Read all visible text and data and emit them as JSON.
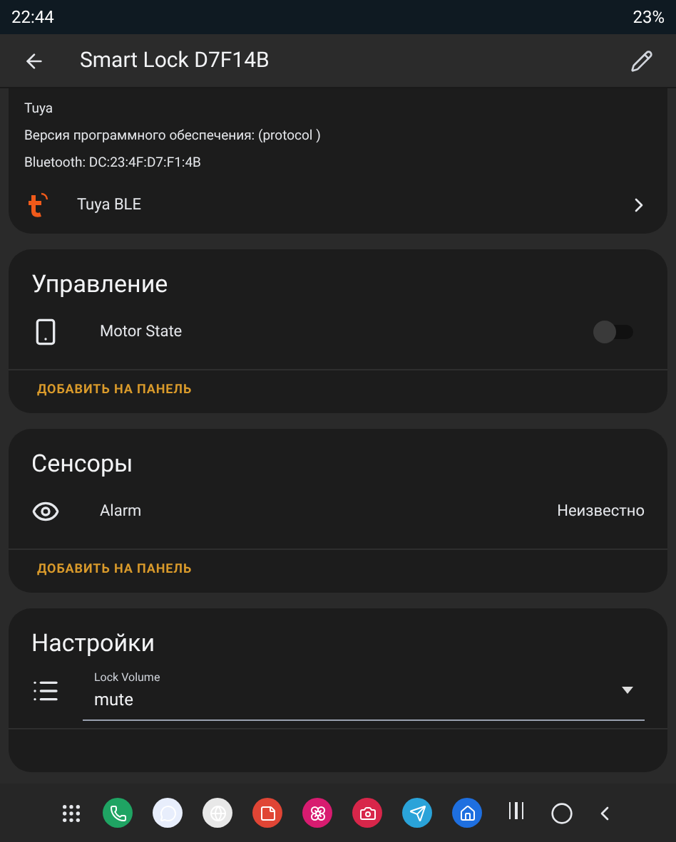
{
  "status_bar": {
    "time": "22:44",
    "battery": "23%"
  },
  "app_bar": {
    "title": "Smart Lock D7F14B"
  },
  "device_info": {
    "lines": [
      "Tuya",
      "Версия программного обеспечения: (protocol )",
      "Bluetooth: DC:23:4F:D7:F1:4B"
    ],
    "integration": "Tuya BLE"
  },
  "cards": [
    {
      "title": "Управление",
      "rows": [
        {
          "kind": "switch",
          "label": "Motor State",
          "on": false
        }
      ],
      "action": "ДОБАВИТЬ НА ПАНЕЛЬ"
    },
    {
      "title": "Сенсоры",
      "rows": [
        {
          "kind": "value",
          "label": "Alarm",
          "value": "Неизвестно"
        }
      ],
      "action": "ДОБАВИТЬ НА ПАНЕЛЬ"
    },
    {
      "title": "Настройки",
      "rows": [
        {
          "kind": "select",
          "label": "Lock Volume",
          "value": "mute"
        }
      ]
    }
  ]
}
